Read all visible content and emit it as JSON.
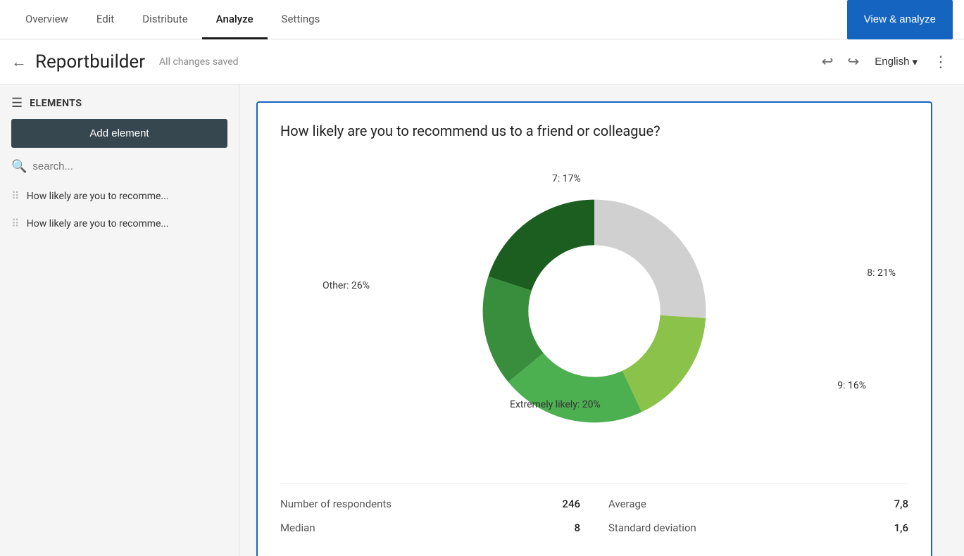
{
  "topNav": {
    "tabs": [
      {
        "label": "Overview",
        "active": false
      },
      {
        "label": "Edit",
        "active": false
      },
      {
        "label": "Distribute",
        "active": false
      },
      {
        "label": "Analyze",
        "active": true
      },
      {
        "label": "Settings",
        "active": false
      }
    ],
    "viewAnalyzeBtn": "View & analyze"
  },
  "header": {
    "backIcon": "←",
    "title": "Reportbuilder",
    "savedStatus": "All changes saved",
    "undoIcon": "↩",
    "redoIcon": "↪",
    "language": "English",
    "chevronIcon": "▾",
    "moreIcon": "⋮"
  },
  "sidebar": {
    "elementsLabel": "ELEMENTS",
    "addElementBtn": "Add element",
    "searchPlaceholder": "search...",
    "items": [
      {
        "label": "How likely are you to recomme..."
      },
      {
        "label": "How likely are you to recomme..."
      }
    ]
  },
  "chart": {
    "title": "How likely are you to recommend us to a friend or colleague?",
    "segments": [
      {
        "label": "7: 17%",
        "value": 17,
        "color": "#8bc34a"
      },
      {
        "label": "8: 21%",
        "value": 21,
        "color": "#4caf50"
      },
      {
        "label": "9: 16%",
        "value": 16,
        "color": "#388e3c"
      },
      {
        "label": "Extremely likely: 20%",
        "value": 20,
        "color": "#1b5e20"
      },
      {
        "label": "Other: 26%",
        "value": 26,
        "color": "#d0d0d0"
      }
    ],
    "stats": [
      {
        "label": "Number of respondents",
        "value": "246"
      },
      {
        "label": "Median",
        "value": "8"
      }
    ],
    "stats2": [
      {
        "label": "Average",
        "value": "7,8"
      },
      {
        "label": "Standard deviation",
        "value": "1,6"
      }
    ]
  }
}
